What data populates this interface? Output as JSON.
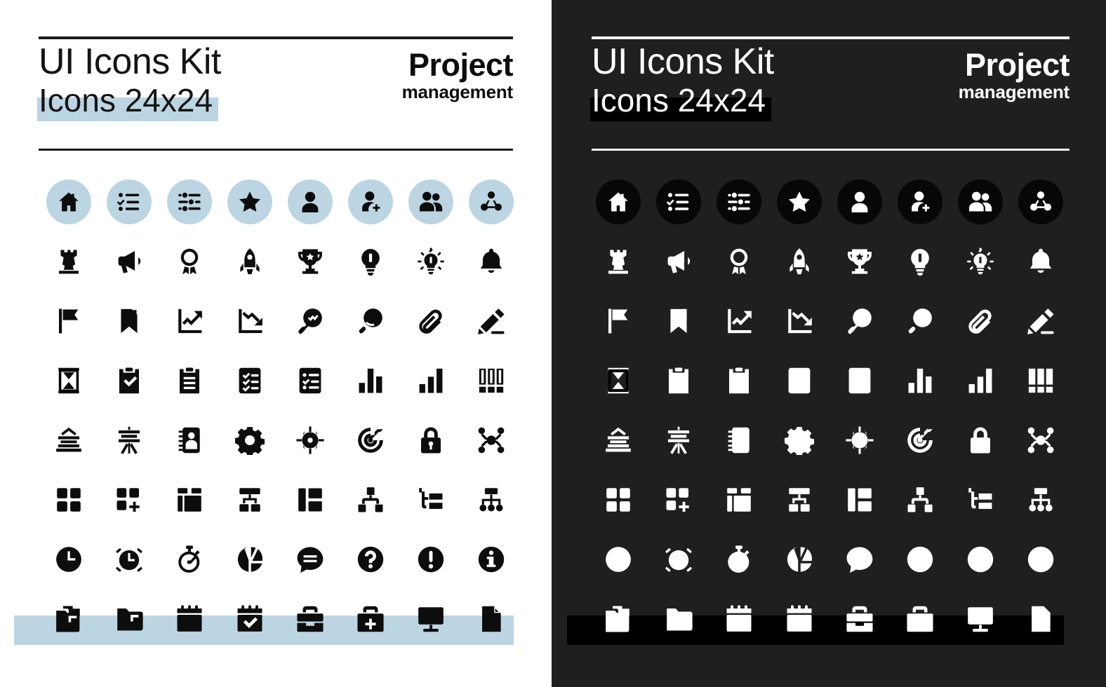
{
  "sheet": {
    "title": "UI Icons Kit",
    "subtitle": "Icons 24x24",
    "brand_line_1": "Project",
    "brand_line_2": "management",
    "accent_light": "#bcd5e3",
    "accent_dark": "#000000",
    "panel_light_bg": "#ffffff",
    "panel_dark_bg": "#1f1f1f",
    "icon_light_color": "#0d0d0d",
    "icon_dark_color": "#ffffff",
    "grid_columns": 8,
    "grid_rows": 8,
    "icon_size": "24x24"
  },
  "panels": [
    {
      "id": "light",
      "theme": "Light theme",
      "name": "panel-light"
    },
    {
      "id": "dark",
      "theme": "Dark theme",
      "name": "panel-dark"
    }
  ],
  "icons": [
    {
      "row": 1,
      "col": 1,
      "name": "home-icon",
      "label": "Home",
      "chip": true
    },
    {
      "row": 1,
      "col": 2,
      "name": "checklist-icon",
      "label": "Checklist",
      "chip": true
    },
    {
      "row": 1,
      "col": 3,
      "name": "sliders-filter-icon",
      "label": "Filters",
      "chip": true
    },
    {
      "row": 1,
      "col": 4,
      "name": "star-icon",
      "label": "Favorite",
      "chip": true
    },
    {
      "row": 1,
      "col": 5,
      "name": "user-icon",
      "label": "User",
      "chip": true
    },
    {
      "row": 1,
      "col": 6,
      "name": "user-add-icon",
      "label": "Add user",
      "chip": true
    },
    {
      "row": 1,
      "col": 7,
      "name": "users-group-icon",
      "label": "Team",
      "chip": true
    },
    {
      "row": 1,
      "col": 8,
      "name": "network-share-icon",
      "label": "Collaboration",
      "chip": true
    },
    {
      "row": 2,
      "col": 1,
      "name": "chess-rook-icon",
      "label": "Strategy",
      "chip": false
    },
    {
      "row": 2,
      "col": 2,
      "name": "megaphone-icon",
      "label": "Announcement",
      "chip": false
    },
    {
      "row": 2,
      "col": 3,
      "name": "award-medal-icon",
      "label": "Award",
      "chip": false
    },
    {
      "row": 2,
      "col": 4,
      "name": "rocket-icon",
      "label": "Launch",
      "chip": false
    },
    {
      "row": 2,
      "col": 5,
      "name": "trophy-icon",
      "label": "Achievement",
      "chip": false
    },
    {
      "row": 2,
      "col": 6,
      "name": "lightbulb-icon",
      "label": "Idea",
      "chip": false
    },
    {
      "row": 2,
      "col": 7,
      "name": "lightbulb-rays-icon",
      "label": "Insight",
      "chip": false
    },
    {
      "row": 2,
      "col": 8,
      "name": "bell-icon",
      "label": "Notification",
      "chip": false
    },
    {
      "row": 3,
      "col": 1,
      "name": "flag-icon",
      "label": "Milestone",
      "chip": false
    },
    {
      "row": 3,
      "col": 2,
      "name": "bookmark-icon",
      "label": "Bookmark",
      "chip": false
    },
    {
      "row": 3,
      "col": 3,
      "name": "chart-trend-up-icon",
      "label": "Growth",
      "chip": false
    },
    {
      "row": 3,
      "col": 4,
      "name": "chart-trend-down-icon",
      "label": "Decline",
      "chip": false
    },
    {
      "row": 3,
      "col": 5,
      "name": "search-analytics-icon",
      "label": "Analysis",
      "chip": false
    },
    {
      "row": 3,
      "col": 6,
      "name": "search-icon",
      "label": "Search",
      "chip": false
    },
    {
      "row": 3,
      "col": 7,
      "name": "paperclip-icon",
      "label": "Attachment",
      "chip": false
    },
    {
      "row": 3,
      "col": 8,
      "name": "pencil-edit-icon",
      "label": "Edit",
      "chip": false
    },
    {
      "row": 4,
      "col": 1,
      "name": "hourglass-icon",
      "label": "Deadline",
      "chip": false
    },
    {
      "row": 4,
      "col": 2,
      "name": "clipboard-check-icon",
      "label": "Approved task",
      "chip": false
    },
    {
      "row": 4,
      "col": 3,
      "name": "clipboard-lines-icon",
      "label": "Brief",
      "chip": false
    },
    {
      "row": 4,
      "col": 4,
      "name": "checklist-board-icon",
      "label": "Task list",
      "chip": false
    },
    {
      "row": 4,
      "col": 5,
      "name": "task-list-icon",
      "label": "Backlog",
      "chip": false
    },
    {
      "row": 4,
      "col": 6,
      "name": "bar-chart-icon",
      "label": "Statistics",
      "chip": false
    },
    {
      "row": 4,
      "col": 7,
      "name": "bar-chart-ascending-icon",
      "label": "Progress chart",
      "chip": false
    },
    {
      "row": 4,
      "col": 8,
      "name": "kanban-columns-icon",
      "label": "Kanban",
      "chip": false
    },
    {
      "row": 5,
      "col": 1,
      "name": "presentation-board-icon",
      "label": "Report",
      "chip": false
    },
    {
      "row": 5,
      "col": 2,
      "name": "flipchart-easel-icon",
      "label": "Presentation",
      "chip": false
    },
    {
      "row": 5,
      "col": 3,
      "name": "contact-card-icon",
      "label": "Contacts",
      "chip": false
    },
    {
      "row": 5,
      "col": 4,
      "name": "gear-settings-icon",
      "label": "Settings",
      "chip": false
    },
    {
      "row": 5,
      "col": 5,
      "name": "crosshair-focus-icon",
      "label": "Focus",
      "chip": false
    },
    {
      "row": 5,
      "col": 6,
      "name": "target-dart-icon",
      "label": "Goal",
      "chip": false
    },
    {
      "row": 5,
      "col": 7,
      "name": "lock-icon",
      "label": "Security",
      "chip": false
    },
    {
      "row": 5,
      "col": 8,
      "name": "nodes-network-icon",
      "label": "Integration",
      "chip": false
    },
    {
      "row": 6,
      "col": 1,
      "name": "grid-layout-icon",
      "label": "Dashboard",
      "chip": false
    },
    {
      "row": 6,
      "col": 2,
      "name": "grid-add-icon",
      "label": "Add widget",
      "chip": false
    },
    {
      "row": 6,
      "col": 3,
      "name": "layout-panels-icon",
      "label": "Layout",
      "chip": false
    },
    {
      "row": 6,
      "col": 4,
      "name": "org-chart-icon",
      "label": "Structure",
      "chip": false
    },
    {
      "row": 6,
      "col": 5,
      "name": "layout-sidebar-icon",
      "label": "Sidebar view",
      "chip": false
    },
    {
      "row": 6,
      "col": 6,
      "name": "hierarchy-icon",
      "label": "Hierarchy",
      "chip": false
    },
    {
      "row": 6,
      "col": 7,
      "name": "tree-branch-icon",
      "label": "Subtasks",
      "chip": false
    },
    {
      "row": 6,
      "col": 8,
      "name": "sitemap-icon",
      "label": "Workflow",
      "chip": false
    },
    {
      "row": 7,
      "col": 1,
      "name": "clock-icon",
      "label": "Time",
      "chip": false
    },
    {
      "row": 7,
      "col": 2,
      "name": "alarm-clock-icon",
      "label": "Reminder",
      "chip": false
    },
    {
      "row": 7,
      "col": 3,
      "name": "stopwatch-icon",
      "label": "Time tracking",
      "chip": false
    },
    {
      "row": 7,
      "col": 4,
      "name": "pie-chart-icon",
      "label": "Distribution",
      "chip": false
    },
    {
      "row": 7,
      "col": 5,
      "name": "chat-message-icon",
      "label": "Comments",
      "chip": false
    },
    {
      "row": 7,
      "col": 6,
      "name": "question-mark-icon",
      "label": "Help",
      "chip": false
    },
    {
      "row": 7,
      "col": 7,
      "name": "exclamation-mark-icon",
      "label": "Alert",
      "chip": false
    },
    {
      "row": 7,
      "col": 8,
      "name": "info-icon",
      "label": "Information",
      "chip": false
    },
    {
      "row": 8,
      "col": 1,
      "name": "folder-documents-icon",
      "label": "Project files",
      "chip": false
    },
    {
      "row": 8,
      "col": 2,
      "name": "folder-icon",
      "label": "Folder",
      "chip": false
    },
    {
      "row": 8,
      "col": 3,
      "name": "calendar-icon",
      "label": "Calendar",
      "chip": false
    },
    {
      "row": 8,
      "col": 4,
      "name": "calendar-check-icon",
      "label": "Scheduled",
      "chip": false
    },
    {
      "row": 8,
      "col": 5,
      "name": "briefcase-icon",
      "label": "Portfolio",
      "chip": false
    },
    {
      "row": 8,
      "col": 6,
      "name": "briefcase-add-icon",
      "label": "New project",
      "chip": false
    },
    {
      "row": 8,
      "col": 7,
      "name": "monitor-icon",
      "label": "Workstation",
      "chip": false
    },
    {
      "row": 8,
      "col": 8,
      "name": "file-document-icon",
      "label": "Document",
      "chip": false
    }
  ]
}
